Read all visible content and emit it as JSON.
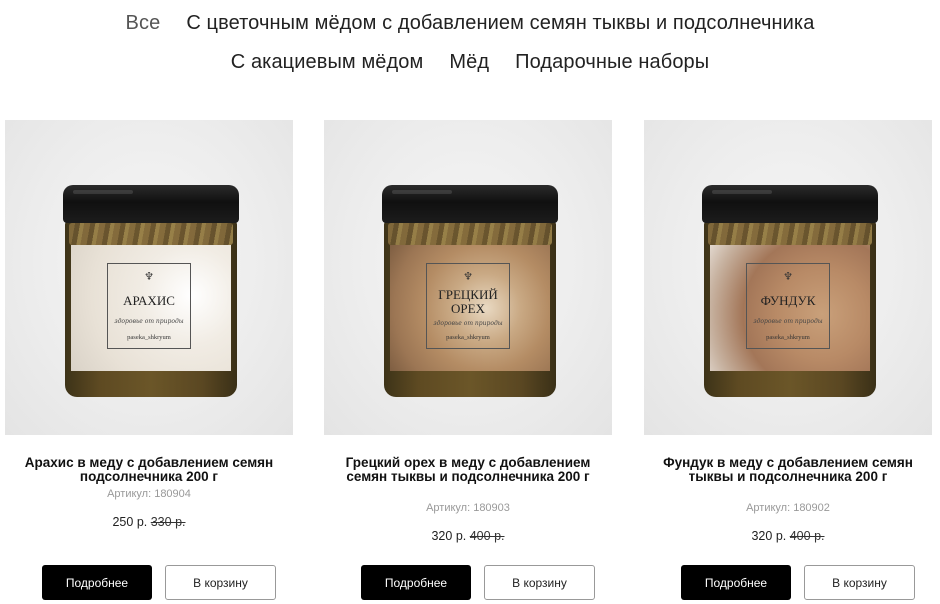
{
  "tabs": [
    {
      "label": "Все",
      "active": true
    },
    {
      "label": "С цветочным мёдом с добавлением семян тыквы и подсолнечника",
      "active": false
    },
    {
      "label": "С акациевым мёдом",
      "active": false
    },
    {
      "label": "Мёд",
      "active": false
    },
    {
      "label": "Подарочные наборы",
      "active": false
    }
  ],
  "products": [
    {
      "title": "Арахис в меду с добавлением семян подсолнечника 200 г",
      "sku": "Артикул: 180904",
      "price": "250 р.",
      "old_price": "330 р.",
      "more_label": "Подробнее",
      "cart_label": "В корзину",
      "jar_label": {
        "name": "АРАХИС",
        "script": "здоровье от природы",
        "insta": "paseka_shkryum"
      }
    },
    {
      "title": "Грецкий орех в меду с добавлением семян тыквы и подсолнечника 200 г",
      "sku": "Артикул: 180903",
      "price": "320 р.",
      "old_price": "400 р.",
      "more_label": "Подробнее",
      "cart_label": "В корзину",
      "jar_label": {
        "name": "ГРЕЦКИЙ ОРЕХ",
        "script": "здоровье от природы",
        "insta": "paseka_shkryum"
      }
    },
    {
      "title": "Фундук в меду с добавлением семян тыквы и подсолнечника 200 г",
      "sku": "Артикул: 180902",
      "price": "320 р.",
      "old_price": "400 р.",
      "more_label": "Подробнее",
      "cart_label": "В корзину",
      "jar_label": {
        "name": "ФУНДУК",
        "script": "здоровье от природы",
        "insta": "paseka_shkryum"
      }
    }
  ],
  "colors": {
    "accent": "#000000",
    "muted": "#999999"
  }
}
